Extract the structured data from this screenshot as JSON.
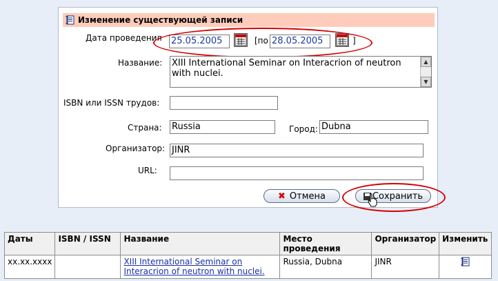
{
  "form": {
    "title": "Изменение существующей записи",
    "date_label": "Дата проведения",
    "date_from": "25.05.2005",
    "date_between": "[по",
    "date_to": "28.05.2005",
    "date_close": "]",
    "name_label": "Название:",
    "name_value": "XIII International Seminar on Interacrion of neutron with nuclei.",
    "isbn_label": "ISBN или ISSN трудов:",
    "isbn_value": "",
    "country_label": "Страна:",
    "country_value": "Russia",
    "city_label": "Город:",
    "city_value": "Dubna",
    "organizer_label": "Организатор:",
    "organizer_value": "JINR",
    "url_label": "URL:",
    "url_value": "",
    "cancel_label": "Отмена",
    "save_label": "Сохранить"
  },
  "table": {
    "headers": [
      "Даты",
      "ISBN / ISSN",
      "Название",
      "Место проведения",
      "Организатор",
      "Изменить"
    ],
    "row": {
      "dates": "xx.xx.xxxx",
      "isbn": "",
      "name": "XIII International Seminar on Interacrion of neutron with nuclei.",
      "place": "Russia, Dubna",
      "organizer": "JINR"
    }
  },
  "icons": [
    "edit-record-icon",
    "calendar-icon",
    "cancel-x-icon",
    "save-disk-icon",
    "cursor-hand-icon"
  ],
  "colors": {
    "header_bg": "#ffccbb",
    "highlight": "#d40000",
    "link": "#1a2fa8",
    "cancel_x": "#d40000"
  }
}
